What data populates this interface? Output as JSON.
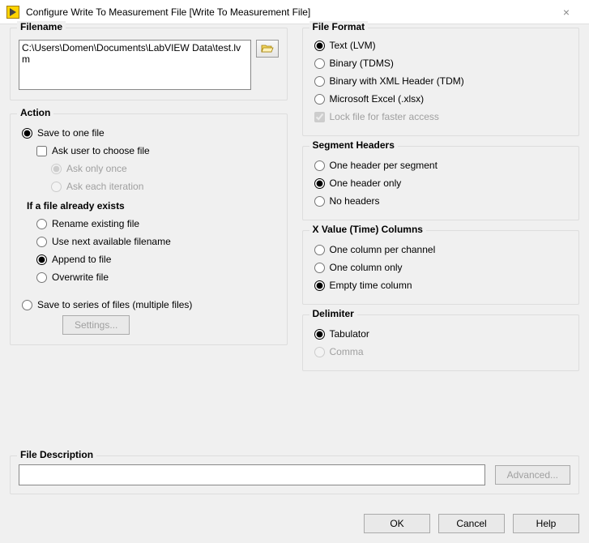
{
  "title": "Configure Write To Measurement File [Write To Measurement File]",
  "groups": {
    "filename": "Filename",
    "action": "Action",
    "existing": "If a file already exists",
    "filedesc": "File Description",
    "fileformat": "File Format",
    "segmenthdr": "Segment Headers",
    "xvalue": "X Value (Time) Columns",
    "delimiter": "Delimiter"
  },
  "filename_path": "C:\\Users\\Domen\\Documents\\LabVIEW Data\\test.lvm",
  "action": {
    "save_one": "Save to one file",
    "ask_user": "Ask user to choose file",
    "ask_once": "Ask only once",
    "ask_each": "Ask each iteration",
    "save_series": "Save to series of files (multiple files)",
    "settings_btn": "Settings..."
  },
  "existing": {
    "rename": "Rename existing file",
    "usenext": "Use next available filename",
    "append": "Append to file",
    "overwrite": "Overwrite file"
  },
  "fileformat": {
    "text": "Text (LVM)",
    "binary": "Binary (TDMS)",
    "binxml": "Binary with XML Header (TDM)",
    "excel": "Microsoft Excel (.xlsx)",
    "lock": "Lock file for faster access"
  },
  "segmenthdr": {
    "perseg": "One header per segment",
    "oneonly": "One header only",
    "none": "No headers"
  },
  "xvalue": {
    "perchan": "One column per channel",
    "oneonly": "One column only",
    "empty": "Empty time column"
  },
  "delimiter": {
    "tab": "Tabulator",
    "comma": "Comma"
  },
  "buttons": {
    "advanced": "Advanced...",
    "ok": "OK",
    "cancel": "Cancel",
    "help": "Help"
  },
  "desc_value": ""
}
